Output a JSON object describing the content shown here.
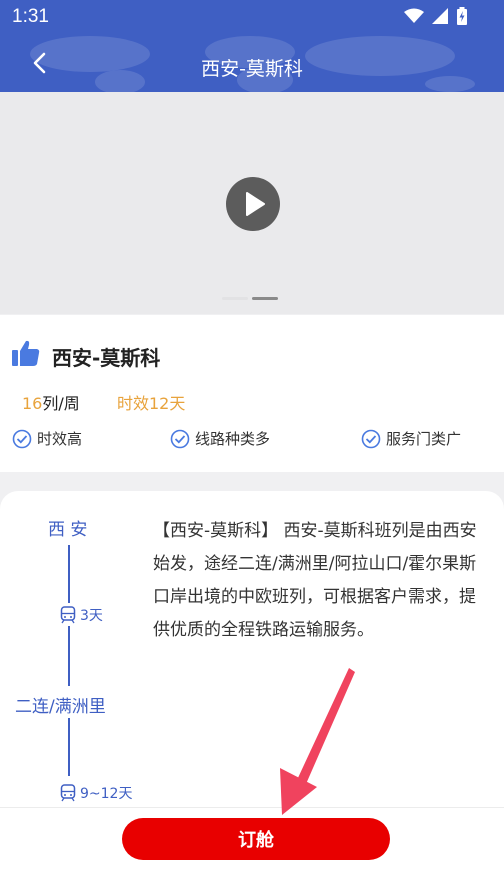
{
  "status_bar": {
    "time": "1:31"
  },
  "nav": {
    "title": "西安-莫斯科"
  },
  "info": {
    "title": "西安-莫斯科",
    "frequency_num": "16",
    "frequency_unit": "列/周",
    "timeliness": "时效12天",
    "features": [
      "时效高",
      "线路种类多",
      "服务门类广"
    ]
  },
  "route": {
    "stations": [
      "西 安",
      "二连/满洲里"
    ],
    "durations": [
      "3天",
      "9~12天"
    ]
  },
  "description": "【西安-莫斯科】 西安-莫斯科班列是由西安始发，途经二连/满洲里/阿拉山口/霍尔果斯口岸出境的中欧班列，可根据客户需求，提供优质的全程铁路运输服务。",
  "actions": {
    "book_label": "订舱"
  },
  "colors": {
    "primary": "#3f5fc3",
    "accent": "#e80000",
    "highlight": "#e8a33c"
  }
}
